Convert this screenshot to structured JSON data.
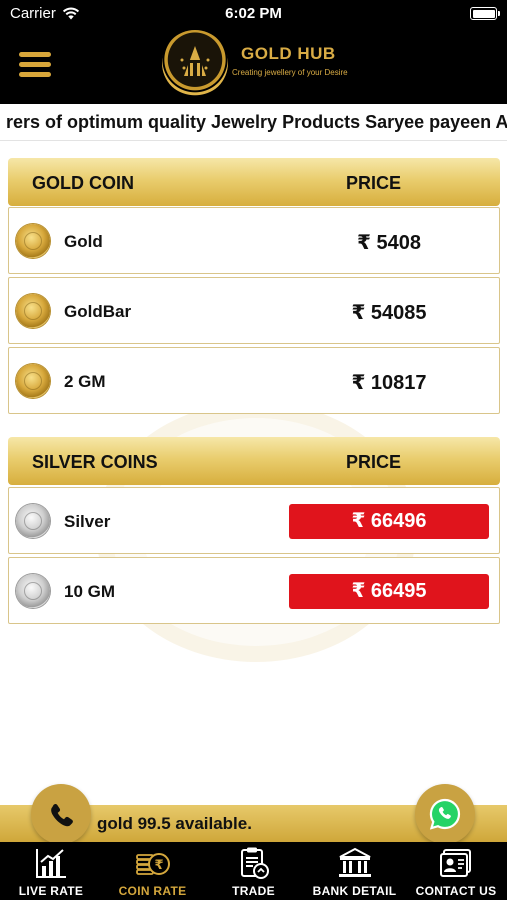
{
  "status_bar": {
    "carrier": "Carrier",
    "time": "6:02 PM"
  },
  "header": {
    "brand": "GOLD HUB",
    "tagline": "Creating jewellery of your Desire"
  },
  "ticker": {
    "text": "rers of optimum quality Jewelry Products Saryee payeen A"
  },
  "gold_section": {
    "title": "GOLD COIN",
    "price_header": "PRICE",
    "items": [
      {
        "name": "Gold",
        "price": "₹ 5408",
        "icon": "gold-coin-icon"
      },
      {
        "name": "GoldBar",
        "price": "₹ 54085",
        "icon": "gold-coin-icon"
      },
      {
        "name": "2 GM",
        "price": "₹ 10817",
        "icon": "gold-coin-icon"
      }
    ]
  },
  "silver_section": {
    "title": "SILVER COINS",
    "price_header": "PRICE",
    "items": [
      {
        "name": "Silver",
        "price": "₹ 66496",
        "icon": "silver-coin-icon"
      },
      {
        "name": "10 GM",
        "price": "₹ 66495",
        "icon": "silver-coin-icon"
      }
    ]
  },
  "announcement": {
    "text": "gold 99.5 available."
  },
  "tabs": [
    {
      "label": "LIVE RATE",
      "icon": "bar-chart-icon",
      "active": false
    },
    {
      "label": "COIN RATE",
      "icon": "coins-icon",
      "active": true
    },
    {
      "label": "TRADE",
      "icon": "trade-clipboard-icon",
      "active": false
    },
    {
      "label": "BANK DETAIL",
      "icon": "bank-icon",
      "active": false
    },
    {
      "label": "CONTACT US",
      "icon": "contact-card-icon",
      "active": false
    }
  ],
  "colors": {
    "accent_gold": "#d4a73d",
    "price_red": "#e0141c",
    "header_bg": "#000000"
  }
}
